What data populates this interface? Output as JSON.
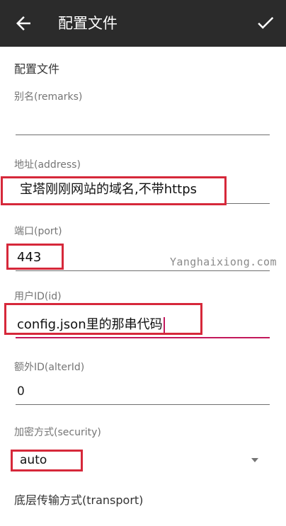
{
  "appbar": {
    "title": "配置文件"
  },
  "section": {
    "title": "配置文件",
    "transport_title": "底层传输方式(transport)"
  },
  "fields": {
    "remarks": {
      "label": "别名(remarks)",
      "value": ""
    },
    "address": {
      "label": "地址(address)",
      "value": "宝塔刚刚网站的域名,不带https"
    },
    "port": {
      "label": "端口(port)",
      "value": "443"
    },
    "id": {
      "label": "用户ID(id)",
      "value": "config.json里的那串代码"
    },
    "alterId": {
      "label": "额外ID(alterId)",
      "value": "0"
    },
    "security": {
      "label": "加密方式(security)",
      "value": "auto"
    }
  },
  "watermark": "Yanghaixiong.com",
  "colors": {
    "appbar": "#2b2b2b",
    "highlight": "#d6283a",
    "accent": "#c2185b"
  }
}
